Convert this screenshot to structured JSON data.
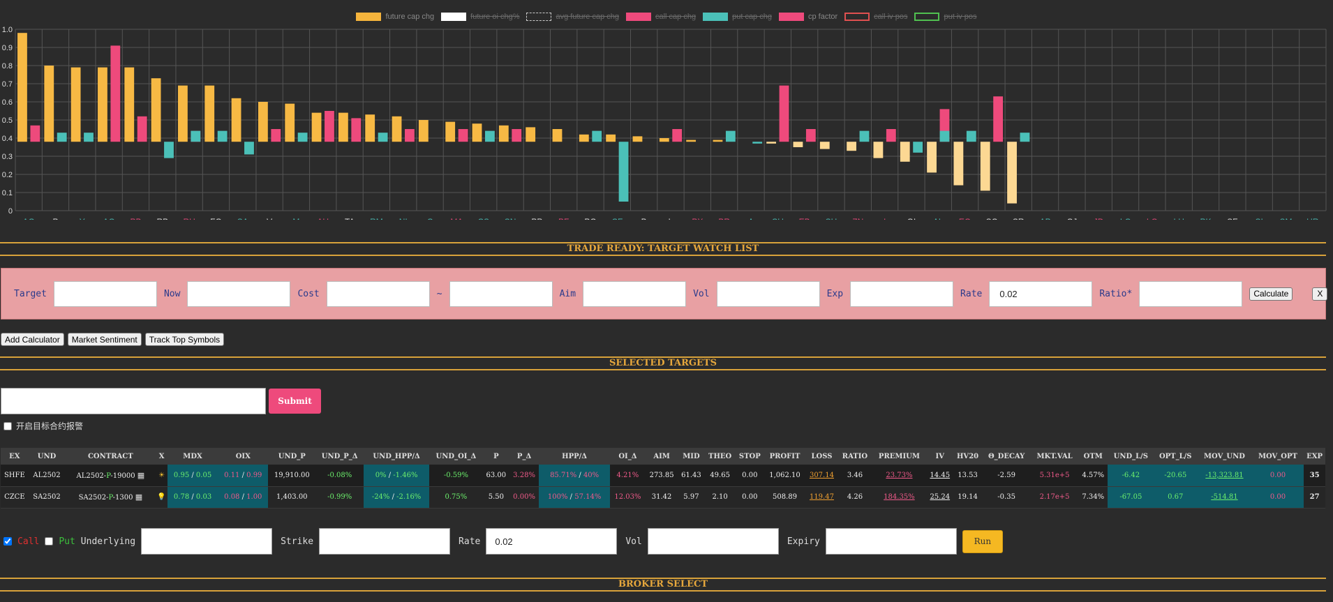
{
  "legend": [
    {
      "label": "future cap chg",
      "color": "#f5b43c",
      "on": true,
      "style": "solid"
    },
    {
      "label": "future oi chg%",
      "color": "#ffffff",
      "on": false,
      "style": "solid"
    },
    {
      "label": "avg future cap chg",
      "color": "#cccccc",
      "on": false,
      "style": "dashed"
    },
    {
      "label": "call cap chg",
      "color": "#ee4a7c",
      "on": false,
      "style": "solid"
    },
    {
      "label": "put cap chg",
      "color": "#4bc0b8",
      "on": false,
      "style": "solid"
    },
    {
      "label": "cp factor",
      "color": "#ee4a7c",
      "on": true,
      "style": "solid"
    },
    {
      "label": "call iv pos",
      "color": "#e05050",
      "on": false,
      "style": "outline"
    },
    {
      "label": "put iv pos",
      "color": "#50c050",
      "on": false,
      "style": "outline"
    }
  ],
  "chart_data": {
    "type": "bar",
    "ylim": [
      0,
      1.0
    ],
    "yticks": [
      "0",
      "0.1",
      "0.2",
      "0.3",
      "0.4",
      "0.5",
      "0.6",
      "0.7",
      "0.8",
      "0.9",
      "1.0"
    ],
    "baseline": 0.38,
    "categories": [
      "AG",
      "P",
      "Y",
      "AO",
      "PB",
      "RB",
      "RU",
      "FG",
      "SA",
      "V",
      "M",
      "AU",
      "TA",
      "RM",
      "NI",
      "C",
      "MA",
      "CS",
      "SN",
      "PP",
      "PF",
      "PG",
      "CF",
      "B",
      "L",
      "PX",
      "BR",
      "A",
      "CU",
      "EB",
      "SH",
      "ZN",
      "I",
      "OI",
      "AL",
      "EG",
      "SC",
      "SR",
      "AP",
      "CJ",
      "JD",
      "LC",
      "LG",
      "LH",
      "PK",
      "SF",
      "SI",
      "SM",
      "UR"
    ],
    "label_colors": [
      "teal",
      "white",
      "teal",
      "teal",
      "pink",
      "white",
      "pink",
      "white",
      "teal",
      "white",
      "teal",
      "pink",
      "white",
      "teal",
      "teal",
      "teal",
      "pink",
      "teal",
      "teal",
      "white",
      "pink",
      "white",
      "teal",
      "white",
      "white",
      "pink",
      "pink",
      "teal",
      "teal",
      "pink",
      "teal",
      "pink",
      "pink",
      "white",
      "teal",
      "pink",
      "white",
      "white",
      "teal",
      "white",
      "pink",
      "teal",
      "pink",
      "teal",
      "teal",
      "white",
      "teal",
      "teal",
      "teal"
    ],
    "future": [
      0.98,
      0.8,
      0.79,
      0.79,
      0.79,
      0.73,
      0.69,
      0.69,
      0.62,
      0.6,
      0.59,
      0.54,
      0.54,
      0.53,
      0.52,
      0.5,
      0.49,
      0.48,
      0.47,
      0.46,
      0.45,
      0.42,
      0.42,
      0.41,
      0.4,
      0.39,
      0.39,
      null,
      0.37,
      0.35,
      0.34,
      0.33,
      0.29,
      0.27,
      0.21,
      0.14,
      0.11,
      0.04,
      null,
      null,
      null,
      null,
      null,
      null,
      null,
      null,
      null,
      null,
      null
    ],
    "cp": [
      0.47,
      null,
      null,
      0.91,
      0.52,
      null,
      0.44,
      null,
      null,
      0.45,
      null,
      0.55,
      0.51,
      null,
      0.45,
      null,
      0.45,
      null,
      0.45,
      null,
      null,
      null,
      null,
      null,
      0.45,
      null,
      null,
      null,
      0.69,
      0.45,
      null,
      null,
      0.45,
      null,
      0.56,
      null,
      0.63,
      null,
      null,
      null,
      null,
      null,
      null,
      null,
      null,
      null,
      null,
      null,
      null
    ],
    "put": [
      null,
      0.43,
      0.43,
      null,
      null,
      0.29,
      0.44,
      0.44,
      0.31,
      null,
      0.43,
      null,
      null,
      0.43,
      null,
      null,
      null,
      0.44,
      null,
      null,
      null,
      0.44,
      0.05,
      null,
      null,
      null,
      0.44,
      0.37,
      null,
      null,
      null,
      0.44,
      null,
      0.32,
      0.44,
      0.44,
      null,
      0.43,
      null,
      null,
      null,
      null,
      null,
      null,
      null,
      null,
      null,
      null,
      null
    ]
  },
  "sections": {
    "watch": "TRADE READY: TARGET WATCH LIST",
    "selected": "SELECTED TARGETS",
    "broker": "BROKER SELECT"
  },
  "watch": {
    "target": "Target",
    "now": "Now",
    "cost": "Cost",
    "tilde": "~",
    "aim": "Aim",
    "vol": "Vol",
    "exp": "Exp",
    "rate": "Rate",
    "rate_value": "0.02",
    "ratio": "Ratio*",
    "calculate": "Calculate",
    "close": "X"
  },
  "toolbar": {
    "add_calc": "Add Calculator",
    "sentiment": "Market Sentiment",
    "track": "Track Top Symbols"
  },
  "submit": {
    "label": "Submit",
    "alarm": "开启目标合约报警"
  },
  "table": {
    "headers": [
      "EX",
      "UND",
      "CONTRACT",
      "X",
      "MDX",
      "OIX",
      "UND_P",
      "UND_P_Δ",
      "UND_HPP/Δ",
      "UND_OI_Δ",
      "P",
      "P_Δ",
      "HPP/Δ",
      "OI_Δ",
      "AIM",
      "MID",
      "THEO",
      "STOP",
      "PROFIT",
      "LOSS",
      "RATIO",
      "PREMIUM",
      "IV",
      "HV20",
      "Θ_DECAY",
      "MKT.VAL",
      "OTM",
      "UND_L/S",
      "OPT_L/S",
      "MOV_UND",
      "MOV_OPT",
      "EXP"
    ],
    "rows": [
      {
        "ex": "SHFE",
        "und": "AL2502",
        "c1": "AL2502-",
        "c2": "P",
        "c3": "-19000",
        "x": "☀",
        "mdx_a": "0.95",
        "mdx_b": "0.05",
        "oix_a": "0.11",
        "oix_b": "0.99",
        "und_p": "19,910.00",
        "und_p_d": "-0.08%",
        "hpp_a": "0%",
        "hpp_b": "-1.46%",
        "und_oi": "-0.59%",
        "p": "63.00",
        "p_d": "3.28%",
        "opt_hpp_a": "85.71%",
        "opt_hpp_b": "40%",
        "oi_d": "4.21%",
        "aim": "273.85",
        "mid": "61.43",
        "theo": "49.65",
        "stop": "0.00",
        "profit": "1,062.10",
        "loss": "307.14",
        "ratio": "3.46",
        "premium": "23.73%",
        "iv": "14.45",
        "hv": "13.53",
        "decay": "-2.59",
        "mkt": "5.31e+5",
        "otm": "4.57%",
        "und_ls": "-6.42",
        "opt_ls": "-20.65",
        "mov_und": "-13,323.81",
        "mov_opt": "0.00",
        "exp": "35"
      },
      {
        "ex": "CZCE",
        "und": "SA2502",
        "c1": "SA2502-",
        "c2": "P",
        "c3": "-1300",
        "x": "💡",
        "mdx_a": "0.78",
        "mdx_b": "0.03",
        "oix_a": "0.08",
        "oix_b": "1.00",
        "und_p": "1,403.00",
        "und_p_d": "-0.99%",
        "hpp_a": "-24%",
        "hpp_b": "-2.16%",
        "und_oi": "0.75%",
        "p": "5.50",
        "p_d": "0.00%",
        "opt_hpp_a": "100%",
        "opt_hpp_b": "57.14%",
        "oi_d": "12.03%",
        "aim": "31.42",
        "mid": "5.97",
        "theo": "2.10",
        "stop": "0.00",
        "profit": "508.89",
        "loss": "119.47",
        "ratio": "4.26",
        "premium": "184.35%",
        "iv": "25.24",
        "hv": "19.14",
        "decay": "-0.35",
        "mkt": "2.17e+5",
        "otm": "7.34%",
        "und_ls": "-67.05",
        "opt_ls": "0.67",
        "mov_und": "-514.81",
        "mov_opt": "0.00",
        "exp": "27"
      }
    ]
  },
  "bs": {
    "call": "Call",
    "put": "Put",
    "underlying": "Underlying",
    "strike": "Strike",
    "rate": "Rate",
    "rate_value": "0.02",
    "vol": "Vol",
    "expiry": "Expiry",
    "run": "Run"
  },
  "colors": {
    "future": "#f7b944",
    "future_neg": "#fcd893",
    "cp": "#ee4a7c",
    "put": "#4bc0b8",
    "teal_label": "#4bc0b8",
    "pink_label": "#ee4a7c"
  }
}
